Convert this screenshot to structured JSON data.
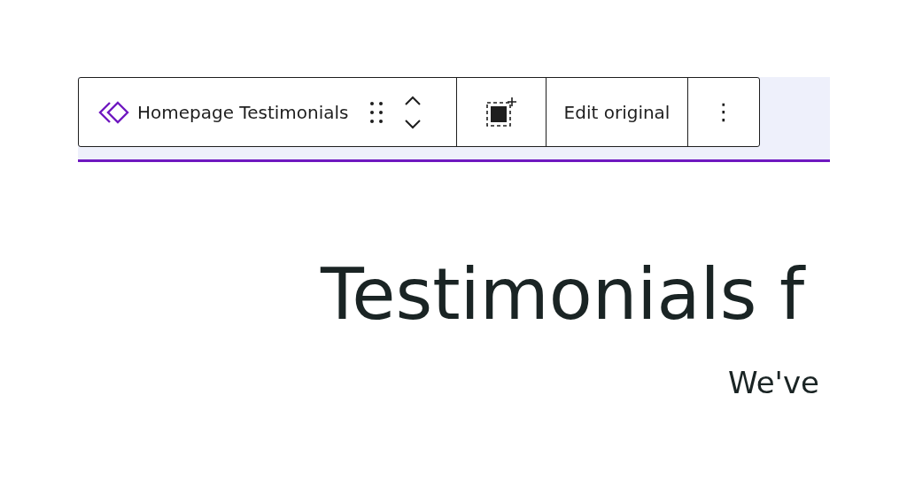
{
  "toolbar": {
    "block_name": "Homepage Testimonials",
    "edit_button": "Edit original",
    "more_menu": "⋮"
  },
  "content": {
    "heading": "Testimonials f",
    "subheading": "We've"
  }
}
